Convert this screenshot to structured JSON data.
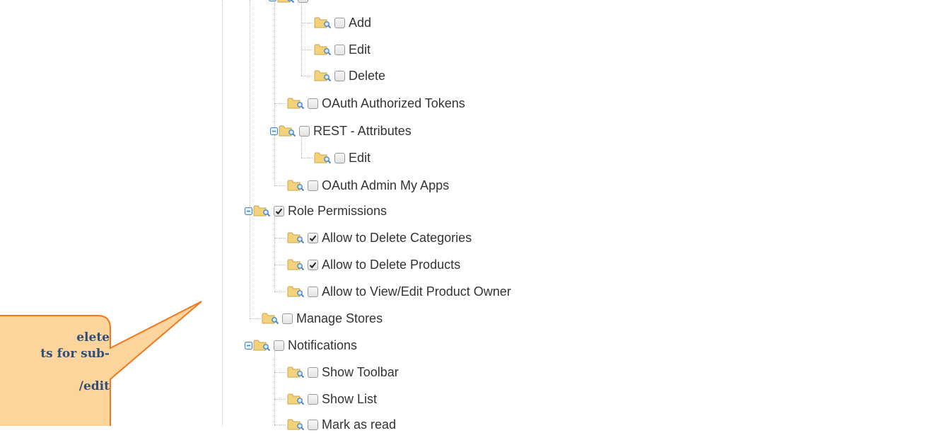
{
  "colors": {
    "callout_fill": "#fdd49c",
    "callout_border": "#f07820",
    "callout_text": "#2f4f7a",
    "folder": "#f2d27a",
    "magnifier": "#4a86c5",
    "expander": "#3a82c4"
  },
  "tree": {
    "items": [
      {
        "label": "Add",
        "checked": false,
        "icon": "folder-magnifier-icon"
      },
      {
        "label": "Edit",
        "checked": false,
        "icon": "folder-magnifier-icon"
      },
      {
        "label": "Delete",
        "checked": false,
        "icon": "folder-magnifier-icon"
      },
      {
        "label": "OAuth Authorized Tokens",
        "checked": false,
        "icon": "folder-magnifier-icon"
      },
      {
        "label": "REST - Attributes",
        "checked": false,
        "expanded": true,
        "icon": "folder-magnifier-icon"
      },
      {
        "label": "Edit",
        "checked": false,
        "icon": "folder-magnifier-icon"
      },
      {
        "label": "OAuth Admin My Apps",
        "checked": false,
        "icon": "folder-magnifier-icon"
      },
      {
        "label": "Role Permissions",
        "checked": true,
        "expanded": true,
        "icon": "folder-magnifier-icon"
      },
      {
        "label": "Allow to Delete Categories",
        "checked": true,
        "icon": "folder-magnifier-icon"
      },
      {
        "label": "Allow to Delete Products",
        "checked": true,
        "icon": "folder-magnifier-icon"
      },
      {
        "label": "Allow to View/Edit Product Owner",
        "checked": false,
        "icon": "folder-magnifier-icon"
      },
      {
        "label": "Manage Stores",
        "checked": false,
        "icon": "folder-magnifier-icon"
      },
      {
        "label": "Notifications",
        "checked": false,
        "expanded": true,
        "icon": "folder-magnifier-icon"
      },
      {
        "label": "Show Toolbar",
        "checked": false,
        "icon": "folder-magnifier-icon"
      },
      {
        "label": "Show List",
        "checked": false,
        "icon": "folder-magnifier-icon"
      },
      {
        "label": "Mark as read",
        "checked": false,
        "icon": "folder-magnifier-icon"
      }
    ]
  },
  "callout": {
    "lines": [
      "elete",
      "ts for sub-",
      "",
      "/edit"
    ]
  }
}
